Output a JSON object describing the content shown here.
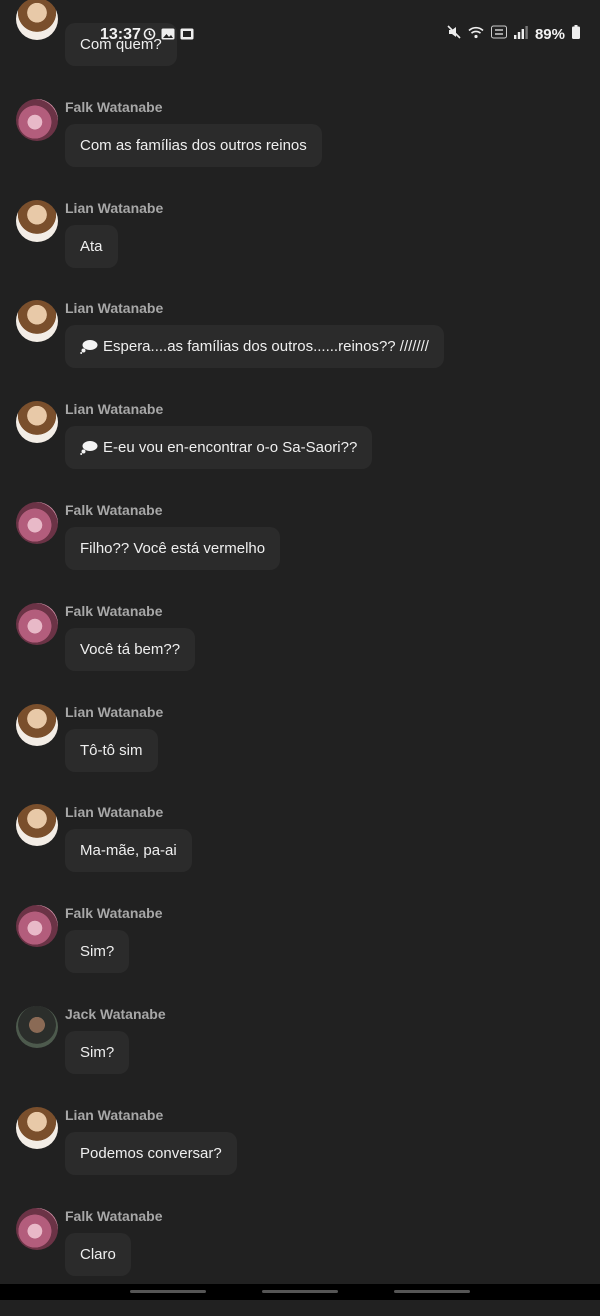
{
  "status_bar": {
    "time": "13:37",
    "battery": "89%",
    "icons": [
      "alarm-icon",
      "image-icon",
      "mute-icon",
      "wifi-icon",
      "volte-icon",
      "signal-icon",
      "battery-icon"
    ]
  },
  "messages": [
    {
      "sender": "",
      "text": "Com quem?",
      "avatar": "lian",
      "thought": false
    },
    {
      "sender": "Falk Watanabe",
      "text": "Com as famílias dos outros reinos",
      "avatar": "falk",
      "thought": false
    },
    {
      "sender": "Lian Watanabe",
      "text": "Ata",
      "avatar": "lian",
      "thought": false
    },
    {
      "sender": "Lian Watanabe",
      "text": "Espera....as famílias dos outros......reinos?? ///////",
      "avatar": "lian",
      "thought": true
    },
    {
      "sender": "Lian Watanabe",
      "text": "E-eu vou en-encontrar o-o Sa-Saori??",
      "avatar": "lian",
      "thought": true
    },
    {
      "sender": "Falk Watanabe",
      "text": "Filho?? Você está vermelho",
      "avatar": "falk",
      "thought": false
    },
    {
      "sender": "Falk Watanabe",
      "text": "Você tá bem??",
      "avatar": "falk",
      "thought": false
    },
    {
      "sender": "Lian Watanabe",
      "text": "Tô-tô sim",
      "avatar": "lian",
      "thought": false
    },
    {
      "sender": "Lian Watanabe",
      "text": "Ma-mãe, pa-ai",
      "avatar": "lian",
      "thought": false
    },
    {
      "sender": "Falk Watanabe",
      "text": "Sim?",
      "avatar": "falk",
      "thought": false
    },
    {
      "sender": "Jack Watanabe",
      "text": "Sim?",
      "avatar": "jack",
      "thought": false
    },
    {
      "sender": "Lian Watanabe",
      "text": "Podemos conversar?",
      "avatar": "lian",
      "thought": false
    },
    {
      "sender": "Falk Watanabe",
      "text": "Claro",
      "avatar": "falk",
      "thought": false
    }
  ]
}
